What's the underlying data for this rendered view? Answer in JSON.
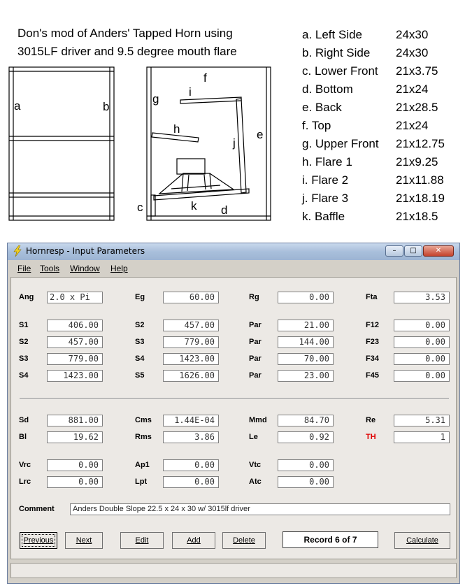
{
  "figure": {
    "title_line1": "Don's mod of Anders' Tapped Horn using",
    "title_line2": "3015LF driver and 9.5 degree mouth flare",
    "parts": [
      {
        "label": "a. Left Side",
        "dim": "24x30"
      },
      {
        "label": "b. Right Side",
        "dim": "24x30"
      },
      {
        "label": "c. Lower Front",
        "dim": "21x3.75"
      },
      {
        "label": "d. Bottom",
        "dim": "21x24"
      },
      {
        "label": "e. Back",
        "dim": "21x28.5"
      },
      {
        "label": "f.  Top",
        "dim": "21x24"
      },
      {
        "label": "g. Upper Front",
        "dim": "21x12.75"
      },
      {
        "label": "h. Flare 1",
        "dim": "21x9.25"
      },
      {
        "label": "i.  Flare 2",
        "dim": "21x11.88"
      },
      {
        "label": "j.  Flare 3",
        "dim": "21x18.19"
      },
      {
        "label": "k. Baffle",
        "dim": "21x18.5"
      }
    ],
    "drawing_labels": {
      "a": "a",
      "b": "b",
      "c": "c",
      "d": "d",
      "e": "e",
      "f": "f",
      "g": "g",
      "h": "h",
      "i": "i",
      "j": "j",
      "k": "k"
    }
  },
  "window": {
    "title": "Hornresp - Input Parameters",
    "controls": {
      "minimize": "–",
      "maximize": "□",
      "close": "✕"
    },
    "menu": [
      "File",
      "Tools",
      "Window",
      "Help"
    ],
    "params": {
      "row1": [
        {
          "label": "Ang",
          "value": "2.0 x Pi"
        },
        {
          "label": "Eg",
          "value": "60.00"
        },
        {
          "label": "Rg",
          "value": "0.00"
        },
        {
          "label": "Fta",
          "value": "3.53"
        }
      ],
      "rows": [
        [
          {
            "label": "S1",
            "value": "406.00"
          },
          {
            "label": "S2",
            "value": "457.00"
          },
          {
            "label": "Par",
            "value": "21.00"
          },
          {
            "label": "F12",
            "value": "0.00"
          }
        ],
        [
          {
            "label": "S2",
            "value": "457.00"
          },
          {
            "label": "S3",
            "value": "779.00"
          },
          {
            "label": "Par",
            "value": "144.00"
          },
          {
            "label": "F23",
            "value": "0.00"
          }
        ],
        [
          {
            "label": "S3",
            "value": "779.00"
          },
          {
            "label": "S4",
            "value": "1423.00"
          },
          {
            "label": "Par",
            "value": "70.00"
          },
          {
            "label": "F34",
            "value": "0.00"
          }
        ],
        [
          {
            "label": "S4",
            "value": "1423.00"
          },
          {
            "label": "S5",
            "value": "1626.00"
          },
          {
            "label": "Par",
            "value": "23.00"
          },
          {
            "label": "F45",
            "value": "0.00"
          }
        ]
      ],
      "driver1": [
        {
          "label": "Sd",
          "value": "881.00"
        },
        {
          "label": "Cms",
          "value": "1.44E-04"
        },
        {
          "label": "Mmd",
          "value": "84.70"
        },
        {
          "label": "Re",
          "value": "5.31"
        }
      ],
      "driver2": [
        {
          "label": "Bl",
          "value": "19.62"
        },
        {
          "label": "Rms",
          "value": "3.86"
        },
        {
          "label": "Le",
          "value": "0.92"
        },
        {
          "label": "TH",
          "value": "1"
        }
      ],
      "chamber1": [
        {
          "label": "Vrc",
          "value": "0.00"
        },
        {
          "label": "Ap1",
          "value": "0.00"
        },
        {
          "label": "Vtc",
          "value": "0.00"
        }
      ],
      "chamber2": [
        {
          "label": "Lrc",
          "value": "0.00"
        },
        {
          "label": "Lpt",
          "value": "0.00"
        },
        {
          "label": "Atc",
          "value": "0.00"
        }
      ]
    },
    "comment_label": "Comment",
    "comment_value": "Anders Double Slope 22.5 x 24 x 30 w/ 3015lf driver",
    "buttons": {
      "previous": "Previous",
      "next": "Next",
      "edit": "Edit",
      "add": "Add",
      "delete": "Delete",
      "record": "Record 6 of 7",
      "calculate": "Calculate"
    },
    "colors": {
      "th_label": "#e00000",
      "titlebar": "#a9bfdb",
      "panel": "#ece9e5"
    }
  }
}
